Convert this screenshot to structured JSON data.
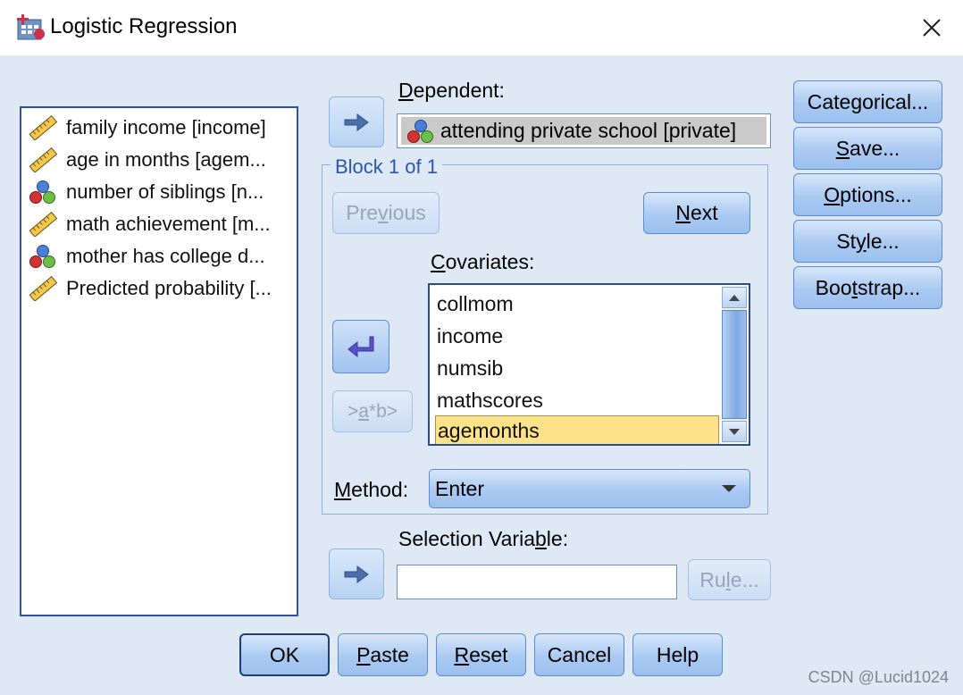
{
  "window": {
    "title": "Logistic Regression",
    "close_glyph": "✕",
    "icon": "spss-dialog-icon"
  },
  "source_vars": [
    {
      "label": "family income [income]",
      "icon": "scale-ruler-icon"
    },
    {
      "label": "age in months [agem...",
      "icon": "scale-ruler-icon"
    },
    {
      "label": "number of siblings [n...",
      "icon": "nominal-balls-icon"
    },
    {
      "label": "math achievement [m...",
      "icon": "scale-ruler-icon"
    },
    {
      "label": "mother has college d...",
      "icon": "nominal-balls-icon"
    },
    {
      "label": "Predicted probability [...",
      "icon": "scale-ruler-icon"
    }
  ],
  "dependent": {
    "label_pre": "",
    "label_key": "D",
    "label_post": "ependent:",
    "value": "attending private school [private]"
  },
  "block": {
    "title": "Block 1 of 1",
    "previous_pre": "Pre",
    "previous_key": "v",
    "previous_post": "ious",
    "next_pre": "",
    "next_key": "N",
    "next_post": "ext"
  },
  "covariates": {
    "label_pre": "",
    "label_key": "C",
    "label_post": "ovariates:",
    "items": [
      "collmom",
      "income",
      "numsib",
      "mathscores",
      "agemonths"
    ],
    "selected": "agemonths"
  },
  "interaction_button": {
    "pre": ">",
    "key": "a",
    "post": "*b>"
  },
  "method": {
    "label_pre": "",
    "label_key": "M",
    "label_post": "ethod:",
    "value": "Enter"
  },
  "selection": {
    "label_pre": "Selection Varia",
    "label_key": "b",
    "label_post": "le:",
    "value": "",
    "rule_pre": "Ru",
    "rule_key": "l",
    "rule_post": "e..."
  },
  "side_buttons": {
    "categorical_pre": "Cate",
    "categorical_key": "g",
    "categorical_post": "orical...",
    "save_pre": "",
    "save_key": "S",
    "save_post": "ave...",
    "options_pre": "",
    "options_key": "O",
    "options_post": "ptions...",
    "style_pre": "St",
    "style_key": "y",
    "style_post": "le...",
    "bootstrap_pre": "Boo",
    "bootstrap_key": "t",
    "bootstrap_post": "strap..."
  },
  "bottom_buttons": {
    "ok": "OK",
    "paste_pre": "",
    "paste_key": "P",
    "paste_post": "aste",
    "reset_pre": "",
    "reset_key": "R",
    "reset_post": "eset",
    "cancel": "Cancel",
    "help": "Help"
  },
  "watermark": "CSDN @Lucid1024",
  "colors": {
    "dialog_bg": "#dfe9f5",
    "button_blue": "#a9c9f1",
    "selection_yellow": "#fde28a",
    "list_border": "#2b5597"
  }
}
